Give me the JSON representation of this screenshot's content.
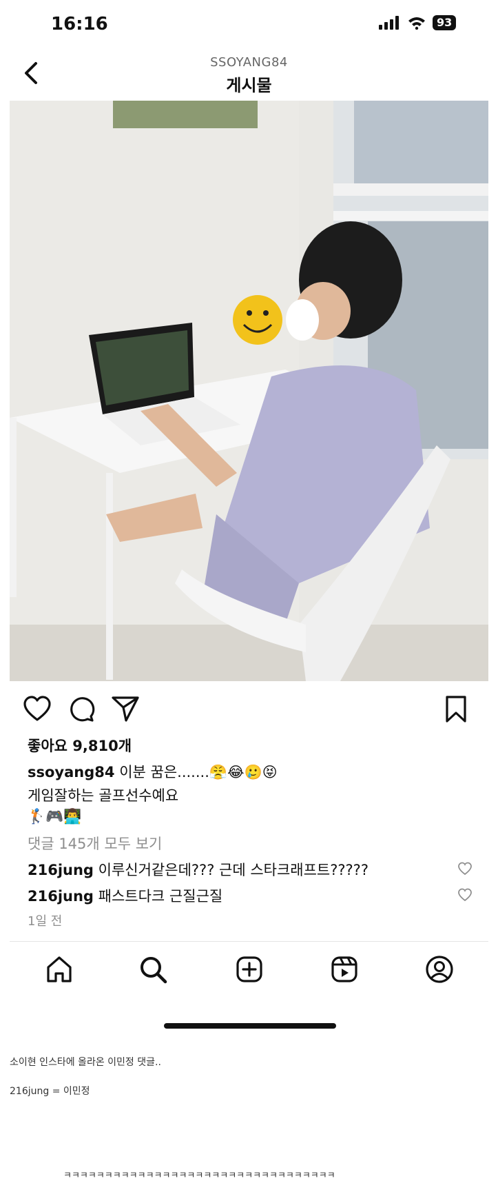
{
  "status_bar": {
    "time": "16:16",
    "battery": "93"
  },
  "header": {
    "username": "SSOYANG84",
    "title": "게시물"
  },
  "post": {
    "likes": "좋아요 9,810개",
    "caption_user": "ssoyang84",
    "caption_text": "이분 꿈은.......",
    "caption_emojis": "😤😂🥲😝",
    "caption_line2": "게임잘하는 골프선수예요",
    "caption_line3": "🏌️🎮👨‍💻",
    "view_comments": "댓글 145개 모두 보기",
    "comments": [
      {
        "user": "216jung",
        "text": "이루신거같은데??? 근데 스타크래프트?????"
      },
      {
        "user": "216jung",
        "text": "패스트다크 근질근질"
      }
    ],
    "time_ago": "1일 전"
  },
  "nav_icons": [
    "home-icon",
    "search-icon",
    "create-icon",
    "reels-icon",
    "profile-icon"
  ],
  "notes": {
    "line1": "소이현 인스타에 올라온 이민정 댓글..",
    "line2": "216jung = 이민정",
    "line3": "ㅋㅋㅋㅋㅋㅋㅋㅋㅋㅋㅋㅋㅋㅋㅋㅋㅋㅋㅋㅋㅋㅋㅋㅋㅋㅋㅋㅋㅋㅋㅋㅋㅋ"
  },
  "colors": {
    "accent": "#111111",
    "secondary_text": "#8e8e8e"
  }
}
